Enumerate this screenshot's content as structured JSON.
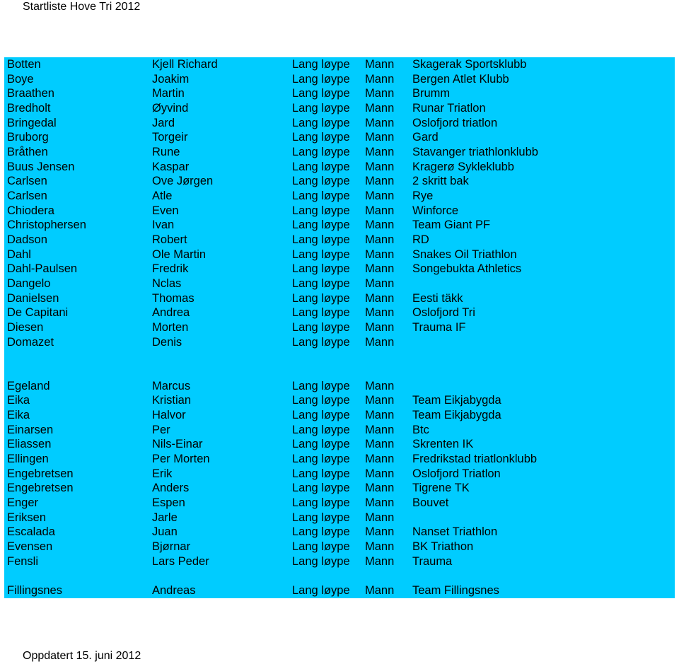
{
  "header": {
    "title": "Startliste Hove Tri 2012"
  },
  "footer": {
    "updated": "Oppdatert 15. juni 2012"
  },
  "table": {
    "background": "#00CCFF",
    "columns": [
      "last_name",
      "first_name",
      "course",
      "gender",
      "club"
    ],
    "groups": [
      [
        [
          "Botten",
          "Kjell Richard",
          "Lang løype",
          "Mann",
          "Skagerak Sportsklubb"
        ],
        [
          "Boye",
          "Joakim",
          "Lang løype",
          "Mann",
          "Bergen Atlet Klubb"
        ],
        [
          "Braathen",
          "Martin",
          "Lang løype",
          "Mann",
          "Brumm"
        ],
        [
          "Bredholt",
          "Øyvind",
          "Lang løype",
          "Mann",
          "Runar Triatlon"
        ],
        [
          "Bringedal",
          "Jard",
          "Lang løype",
          "Mann",
          "Oslofjord triatlon"
        ],
        [
          "Bruborg",
          "Torgeir",
          "Lang løype",
          "Mann",
          "Gard"
        ],
        [
          "Bråthen",
          "Rune",
          "Lang løype",
          "Mann",
          "Stavanger triathlonklubb"
        ],
        [
          "Buus Jensen",
          "Kaspar",
          "Lang løype",
          "Mann",
          "Kragerø Sykleklubb"
        ],
        [
          "Carlsen",
          "Ove Jørgen",
          "Lang løype",
          "Mann",
          "2 skritt bak"
        ],
        [
          "Carlsen",
          "Atle",
          "Lang løype",
          "Mann",
          "Rye"
        ],
        [
          "Chiodera",
          "Even",
          "Lang løype",
          "Mann",
          "Winforce"
        ],
        [
          "Christophersen",
          "Ivan",
          "Lang løype",
          "Mann",
          "Team Giant PF"
        ],
        [
          "Dadson",
          "Robert",
          "Lang løype",
          "Mann",
          "RD"
        ],
        [
          "Dahl",
          "Ole Martin",
          "Lang løype",
          "Mann",
          "Snakes Oil Triathlon"
        ],
        [
          "Dahl-Paulsen",
          "Fredrik",
          "Lang løype",
          "Mann",
          "Songebukta Athletics"
        ],
        [
          "Dangelo",
          "Nclas",
          "Lang løype",
          "Mann",
          ""
        ],
        [
          "Danielsen",
          "Thomas",
          "Lang løype",
          "Mann",
          "Eesti täkk"
        ],
        [
          "De Capitani",
          "Andrea",
          "Lang løype",
          "Mann",
          "Oslofjord Tri"
        ],
        [
          "Diesen",
          "Morten",
          "Lang løype",
          "Mann",
          "Trauma IF"
        ],
        [
          "Domazet",
          "Denis",
          "Lang løype",
          "Mann",
          ""
        ]
      ],
      [
        [
          "Egeland",
          "Marcus",
          "Lang løype",
          "Mann",
          ""
        ],
        [
          "Eika",
          "Kristian",
          "Lang løype",
          "Mann",
          "Team Eikjabygda"
        ],
        [
          "Eika",
          "Halvor",
          "Lang løype",
          "Mann",
          "Team Eikjabygda"
        ],
        [
          "Einarsen",
          "Per",
          "Lang løype",
          "Mann",
          "Btc"
        ],
        [
          "Eliassen",
          "Nils-Einar",
          "Lang løype",
          "Mann",
          "Skrenten IK"
        ],
        [
          "Ellingen",
          "Per Morten",
          "Lang løype",
          "Mann",
          "Fredrikstad triatlonklubb"
        ],
        [
          "Engebretsen",
          "Erik",
          "Lang løype",
          "Mann",
          "Oslofjord Triatlon"
        ],
        [
          "Engebretsen",
          "Anders",
          "Lang løype",
          "Mann",
          "Tigrene TK"
        ],
        [
          "Enger",
          "Espen",
          "Lang løype",
          "Mann",
          "Bouvet"
        ],
        [
          "Eriksen",
          "Jarle",
          "Lang løype",
          "Mann",
          ""
        ],
        [
          "Escalada",
          "Juan",
          "Lang løype",
          "Mann",
          "Nanset Triathlon"
        ],
        [
          "Evensen",
          "Bjørnar",
          "Lang løype",
          "Mann",
          "BK Triathon"
        ],
        [
          "Fensli",
          "Lars Peder",
          "Lang løype",
          "Mann",
          "Trauma"
        ]
      ],
      [
        [
          "Fillingsnes",
          "Andreas",
          "Lang løype",
          "Mann",
          "Team Fillingsnes"
        ]
      ]
    ]
  }
}
